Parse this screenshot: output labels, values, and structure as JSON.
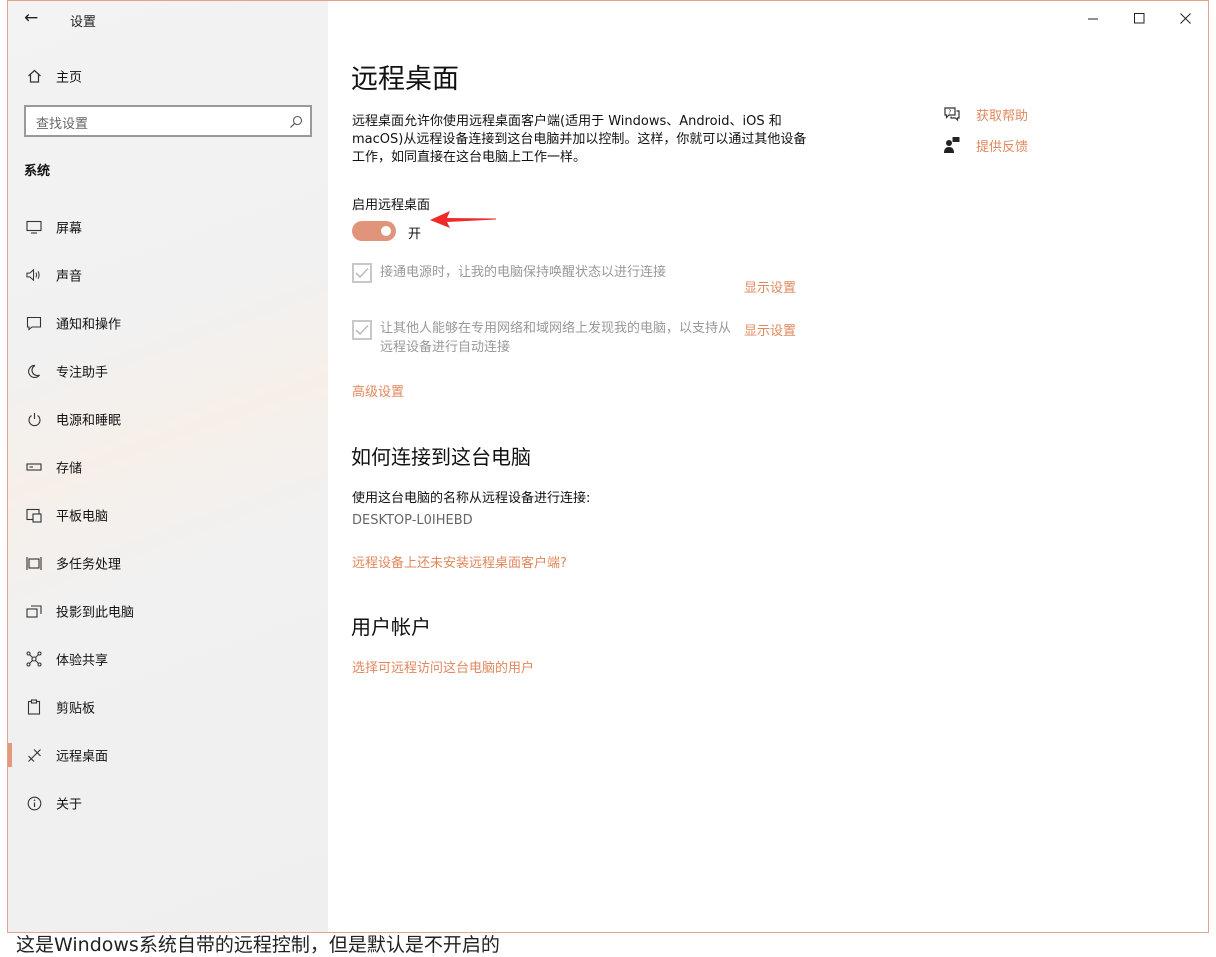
{
  "app": {
    "title": "设置"
  },
  "window_controls": {
    "minimize_icon": "minimize-icon",
    "maximize_icon": "maximize-icon",
    "close_icon": "close-icon"
  },
  "sidebar": {
    "home": {
      "label": "主页",
      "icon": "home-icon"
    },
    "search": {
      "placeholder": "查找设置",
      "icon": "search-icon"
    },
    "section": "系统",
    "items": [
      {
        "label": "屏幕",
        "icon": "monitor-icon"
      },
      {
        "label": "声音",
        "icon": "speaker-icon"
      },
      {
        "label": "通知和操作",
        "icon": "message-icon"
      },
      {
        "label": "专注助手",
        "icon": "moon-icon"
      },
      {
        "label": "电源和睡眠",
        "icon": "power-icon"
      },
      {
        "label": "存储",
        "icon": "storage-icon"
      },
      {
        "label": "平板电脑",
        "icon": "tablet-icon"
      },
      {
        "label": "多任务处理",
        "icon": "multitask-icon"
      },
      {
        "label": "投影到此电脑",
        "icon": "project-icon"
      },
      {
        "label": "体验共享",
        "icon": "share-icon"
      },
      {
        "label": "剪贴板",
        "icon": "clipboard-icon"
      },
      {
        "label": "远程桌面",
        "icon": "remote-desktop-icon",
        "active": true
      },
      {
        "label": "关于",
        "icon": "info-icon"
      }
    ]
  },
  "main": {
    "title": "远程桌面",
    "description": "远程桌面允许你使用远程桌面客户端(适用于 Windows、Android、iOS 和 macOS)从远程设备连接到这台电脑并加以控制。这样，你就可以通过其他设备工作，如同直接在这台电脑上工作一样。",
    "help": {
      "get_help": "获取帮助",
      "feedback": "提供反馈"
    },
    "toggle": {
      "label": "启用远程桌面",
      "state": "开",
      "on": true
    },
    "checkbox1": {
      "text": "接通电源时，让我的电脑保持唤醒状态以进行连接",
      "checked": true,
      "link": "显示设置"
    },
    "checkbox2": {
      "text": "让其他人能够在专用网络和域网络上发现我的电脑，以支持从远程设备进行自动连接",
      "checked": true,
      "link": "显示设置"
    },
    "advanced_link": "高级设置",
    "connect": {
      "heading": "如何连接到这台电脑",
      "text": "使用这台电脑的名称从远程设备进行连接:",
      "pc_name": "DESKTOP-L0IHEBD",
      "client_link": "远程设备上还未安装远程桌面客户端?"
    },
    "accounts": {
      "heading": "用户帐户",
      "link": "选择可远程访问这台电脑的用户"
    }
  },
  "caption": "这是Windows系统自带的远程控制，但是默认是不开启的",
  "colors": {
    "accent": "#e0885c",
    "toggle_on": "#e0957a",
    "disabled_text": "#999999"
  }
}
